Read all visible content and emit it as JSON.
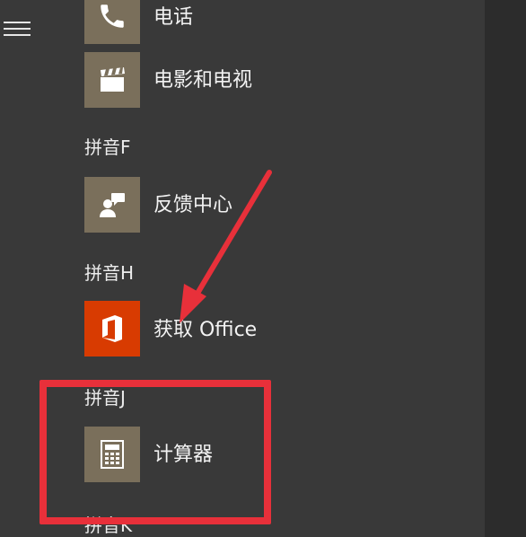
{
  "start_menu": {
    "items": [
      {
        "type": "app",
        "label": "电话",
        "icon": "phone-icon"
      },
      {
        "type": "app",
        "label": "电影和电视",
        "icon": "film-clapper-icon"
      },
      {
        "type": "header",
        "label": "拼音F"
      },
      {
        "type": "app",
        "label": "反馈中心",
        "icon": "feedback-hub-icon"
      },
      {
        "type": "header",
        "label": "拼音H"
      },
      {
        "type": "app",
        "label": "获取 Office",
        "icon": "office-logo-icon"
      },
      {
        "type": "header",
        "label": "拼音J"
      },
      {
        "type": "app",
        "label": "计算器",
        "icon": "calculator-icon"
      },
      {
        "type": "header",
        "label": "拼音K"
      }
    ]
  },
  "colors": {
    "background": "#393939",
    "tile": "#7a6f5b",
    "office_tile": "#d83b01",
    "annotation": "#e8303a"
  }
}
